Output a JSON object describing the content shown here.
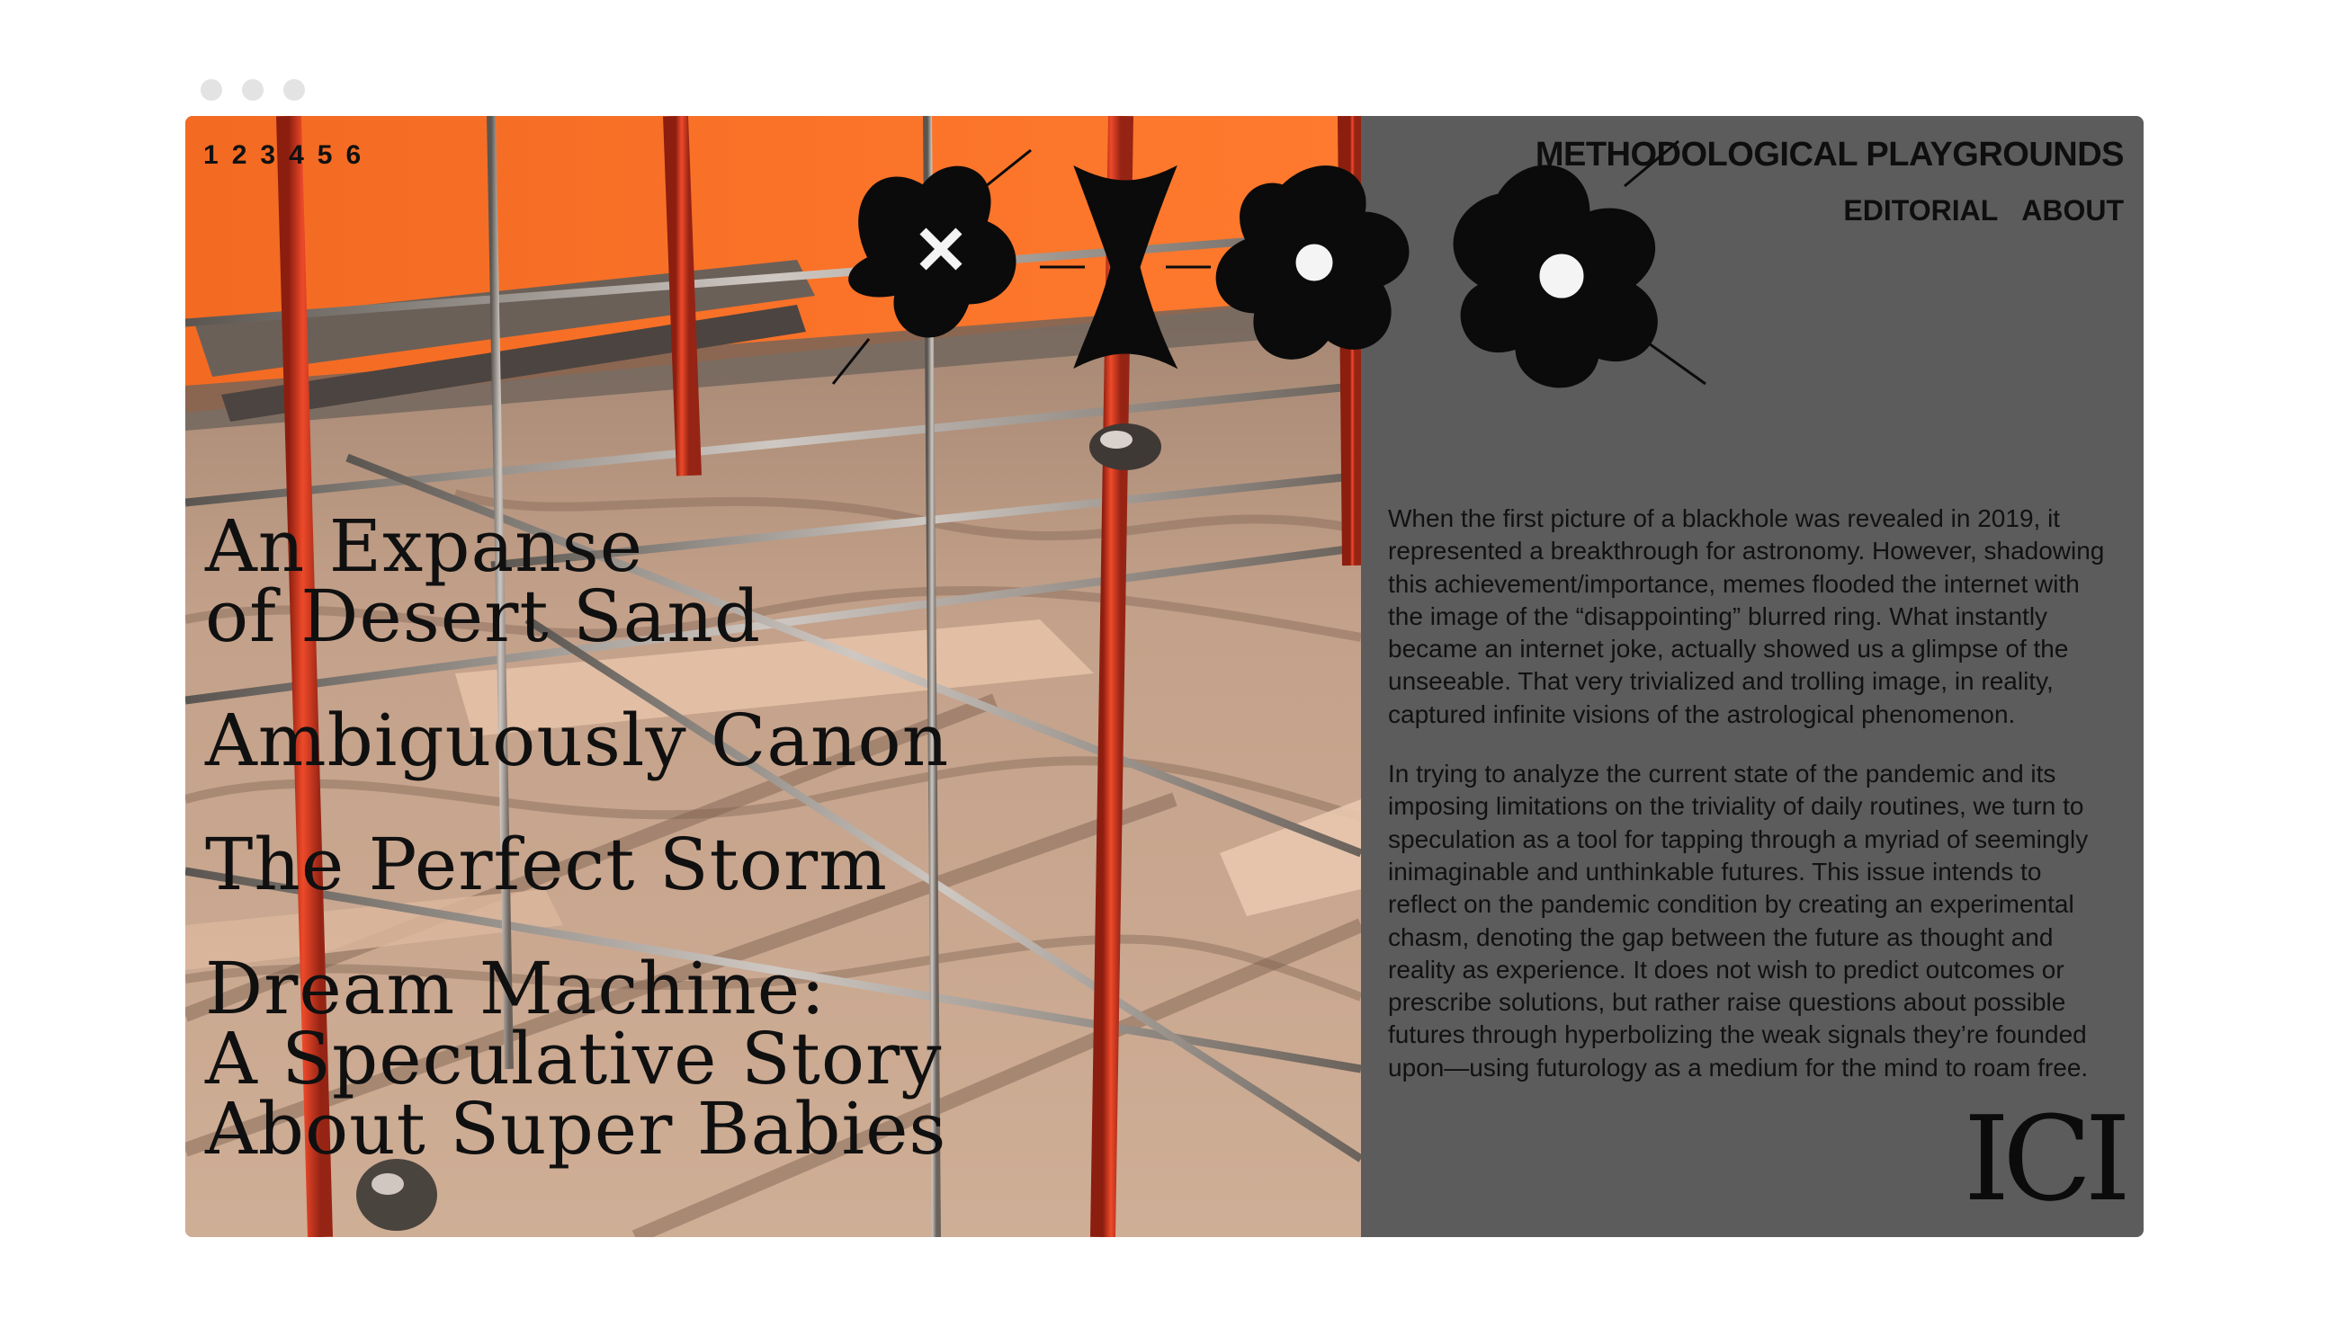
{
  "window": {
    "controls": [
      "close",
      "minimize",
      "zoom"
    ]
  },
  "pager": {
    "items": [
      "1",
      "2",
      "3",
      "4",
      "5",
      "6"
    ]
  },
  "logo": {
    "name": "stylized-glyph-logo"
  },
  "header": {
    "site_title": "METHODOLOGICAL PLAYGROUNDS",
    "links": [
      "EDITORIAL",
      "ABOUT"
    ]
  },
  "articles": [
    "An Expanse\nof Desert Sand",
    "Ambiguously Canon",
    "The Perfect Storm",
    "Dream Machine:\nA Speculative Story\nAbout Super Babies"
  ],
  "intro": {
    "paragraphs": [
      "When the first picture of a blackhole was revealed in 2019, it represented a breakthrough for astronomy. However, shadowing this achievement/importance, memes flooded the internet with the image of the “disappointing” blurred ring. What instantly became an internet joke, actually showed us a glimpse of the unseeable. That very trivialized and trolling image, in reality, captured infinite visions of the astrological phenomenon.",
      "In trying to analyze the current state of the pandemic and its imposing limitations on the triviality of daily routines, we turn to speculation as a tool for tapping through a myriad of seemingly inimaginable and unthinkable futures. This issue intends to reflect on the pandemic condition by creating an experimental chasm, denoting the gap between the future as thought and reality as experience. It does not wish to predict outcomes or prescribe solutions, but rather raise questions about possible futures through hyperbolizing the weak signals they’re founded upon—using futurology as a medium for the mind to roam free."
    ]
  },
  "badge": {
    "text": "ICI"
  },
  "colors": {
    "orange": "#f26a24",
    "panel": "#5c5c5c",
    "sand": "#c7a58c",
    "red_pole": "#d33a1f"
  }
}
